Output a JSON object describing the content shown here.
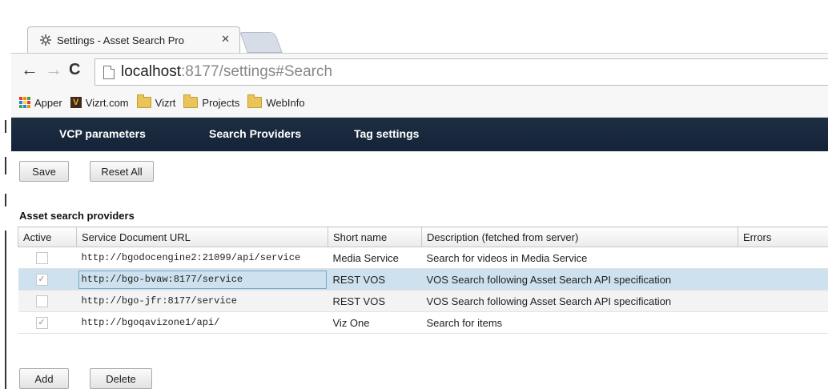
{
  "browser": {
    "tab": {
      "title": "Settings - Asset Search Pro"
    },
    "toolbar": {
      "url_host": "localhost",
      "url_rest": ":8177/settings#Search"
    },
    "bookmarks": [
      {
        "label": "Apper",
        "icon": "apps-icon"
      },
      {
        "label": "Vizrt.com",
        "icon": "vizrt-icon"
      },
      {
        "label": "Vizrt",
        "icon": "folder-icon"
      },
      {
        "label": "Projects",
        "icon": "folder-icon"
      },
      {
        "label": "WebInfo",
        "icon": "folder-icon"
      }
    ]
  },
  "app_nav": {
    "items": [
      "VCP parameters",
      "Search Providers",
      "Tag settings"
    ],
    "bg_color": "#1a2a3f"
  },
  "actions": {
    "save_label": "Save",
    "reset_label": "Reset All",
    "add_label": "Add",
    "delete_label": "Delete"
  },
  "providers": {
    "title": "Asset search providers",
    "columns": [
      "Active",
      "Service Document URL",
      "Short name",
      "Description (fetched from server)",
      "Errors"
    ],
    "rows": [
      {
        "active": false,
        "url": "http://bgodocengine2:21099/api/service",
        "short_name": "Media Service",
        "description": "Search for videos in Media Service",
        "errors": ""
      },
      {
        "active": true,
        "url": "http://bgo-bvaw:8177/service",
        "short_name": "REST VOS",
        "description": "VOS Search following Asset Search API specification",
        "errors": ""
      },
      {
        "active": false,
        "url": "http://bgo-jfr:8177/service",
        "short_name": "REST VOS",
        "description": "VOS Search following Asset Search API specification",
        "errors": ""
      },
      {
        "active": true,
        "url": "http://bgoqavizone1/api/",
        "short_name": "Viz One",
        "description": "Search for items",
        "errors": ""
      }
    ]
  }
}
